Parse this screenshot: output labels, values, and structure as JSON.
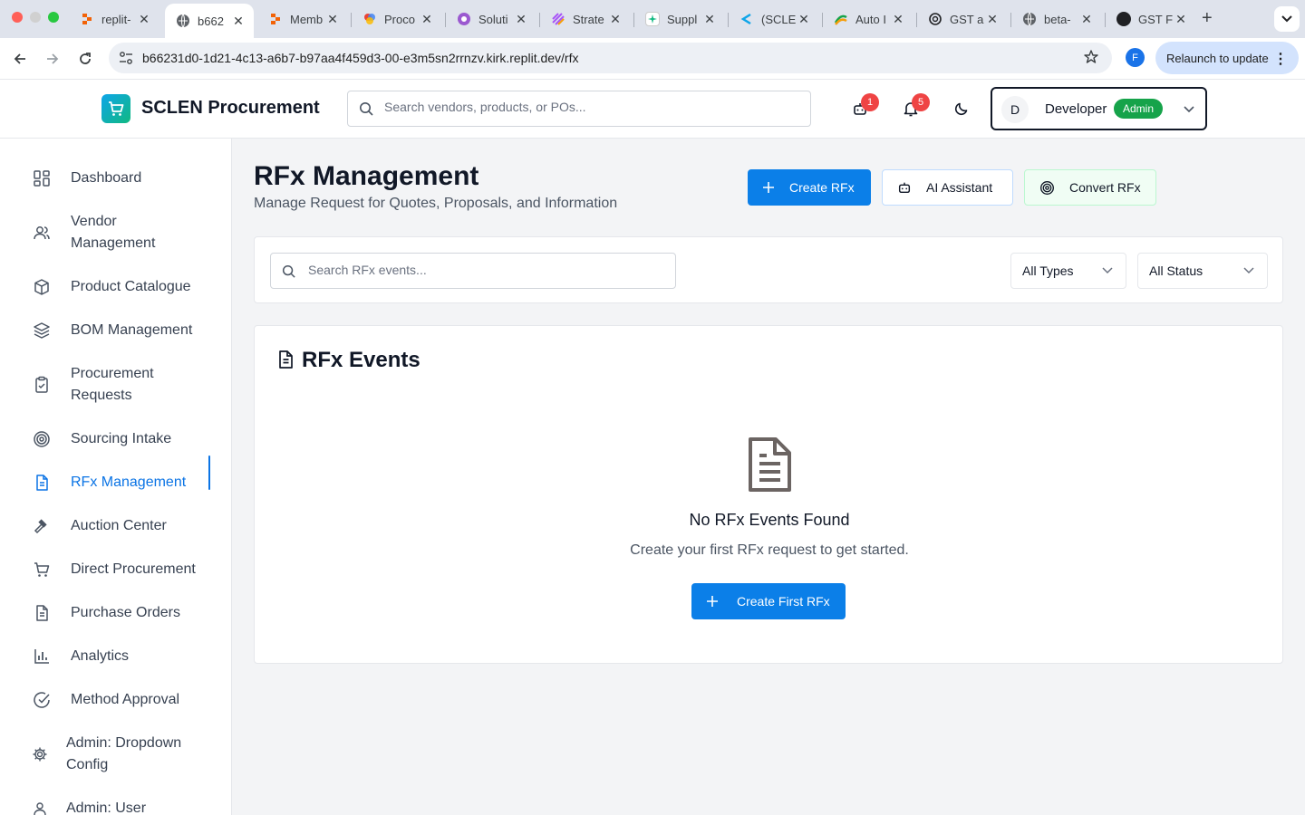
{
  "browser": {
    "tabs": [
      {
        "label": "replit-",
        "icon": "replit-icon"
      },
      {
        "label": "b662",
        "icon": "globe-icon",
        "active": true
      },
      {
        "label": "Memb",
        "icon": "replit-icon"
      },
      {
        "label": "Proco",
        "icon": "colorful-circles-icon"
      },
      {
        "label": "Soluti",
        "icon": "purple-logo-icon"
      },
      {
        "label": "Strate",
        "icon": "stripes-icon"
      },
      {
        "label": "Suppl",
        "icon": "sparkle-icon"
      },
      {
        "label": "(SCLE",
        "icon": "s-logo-icon"
      },
      {
        "label": "Auto I",
        "icon": "arrows-icon"
      },
      {
        "label": "GST a",
        "icon": "openai-icon"
      },
      {
        "label": "beta-",
        "icon": "globe-icon"
      },
      {
        "label": "GST F",
        "icon": "dark-circle-icon"
      }
    ],
    "url": "b66231d0-1d21-4c13-a6b7-b97aa4f459d3-00-e3m5sn2rrnzv.kirk.replit.dev/rfx",
    "profile_initial": "F",
    "relaunch_label": "Relaunch to update"
  },
  "header": {
    "brand": "SCLEN Procurement",
    "search_placeholder": "Search vendors, products, or POs...",
    "bot_badge": "1",
    "notification_badge": "5",
    "user": {
      "initial": "D",
      "name": "Developer",
      "role": "Admin"
    }
  },
  "sidebar": {
    "items": [
      {
        "label": "Dashboard",
        "icon": "dashboard-icon"
      },
      {
        "label": "Vendor Management",
        "icon": "users-icon"
      },
      {
        "label": "Product Catalogue",
        "icon": "box-icon"
      },
      {
        "label": "BOM Management",
        "icon": "layers-icon"
      },
      {
        "label": "Procurement Requests",
        "icon": "clipboard-check-icon"
      },
      {
        "label": "Sourcing Intake",
        "icon": "target-icon"
      },
      {
        "label": "RFx Management",
        "icon": "file-text-icon",
        "active": true
      },
      {
        "label": "Auction Center",
        "icon": "gavel-icon"
      },
      {
        "label": "Direct Procurement",
        "icon": "cart-icon"
      },
      {
        "label": "Purchase Orders",
        "icon": "file-text-icon"
      },
      {
        "label": "Analytics",
        "icon": "bar-chart-icon"
      },
      {
        "label": "Method Approval",
        "icon": "check-circle-icon"
      },
      {
        "label": "Admin: Dropdown Config",
        "icon": "gear-icon"
      },
      {
        "label": "Admin: User",
        "icon": "user-icon"
      }
    ]
  },
  "main": {
    "title": "RFx Management",
    "subtitle": "Manage Request for Quotes, Proposals, and Information",
    "buttons": {
      "create": "Create RFx",
      "ai": "AI Assistant",
      "convert": "Convert RFx"
    },
    "filters": {
      "search_placeholder": "Search RFx events...",
      "type_value": "All Types",
      "status_value": "All Status"
    },
    "events": {
      "title": "RFx Events",
      "empty_title": "No RFx Events Found",
      "empty_subtitle": "Create your first RFx request to get started.",
      "empty_button": "Create First RFx"
    }
  },
  "colors": {
    "primary": "#0b7fe8",
    "active_nav": "#0b74e5",
    "role_badge": "#16a34a",
    "notification_badge": "#ef4444"
  }
}
